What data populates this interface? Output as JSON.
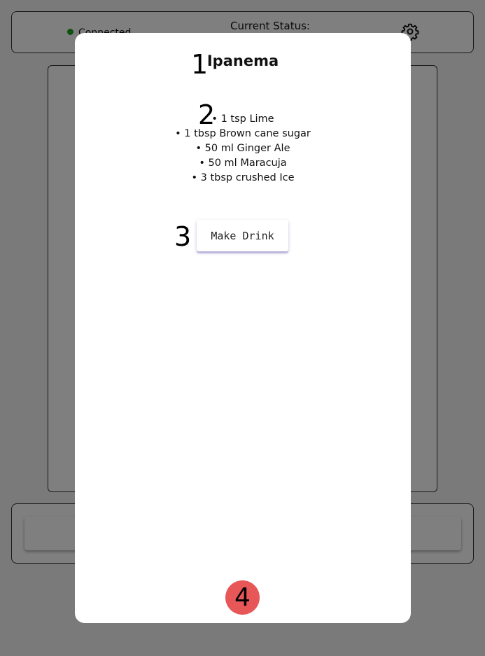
{
  "status": {
    "connection_label": "Connected",
    "status_label": "Current Status:"
  },
  "modal": {
    "title": "Ipanema",
    "ingredients": [
      "1 tsp Lime",
      "1 tbsp Brown cane sugar",
      "50 ml Ginger Ale",
      "50 ml Maracuja",
      "3 tbsp crushed Ice"
    ],
    "make_drink_label": "Make Drink"
  },
  "markers": {
    "m1": "1",
    "m2": "2",
    "m3": "3",
    "m4": "4"
  },
  "colors": {
    "connected_dot": "#1ea21e",
    "badge": "#e85757",
    "overlay": "rgba(0,0,0,0.5)"
  }
}
